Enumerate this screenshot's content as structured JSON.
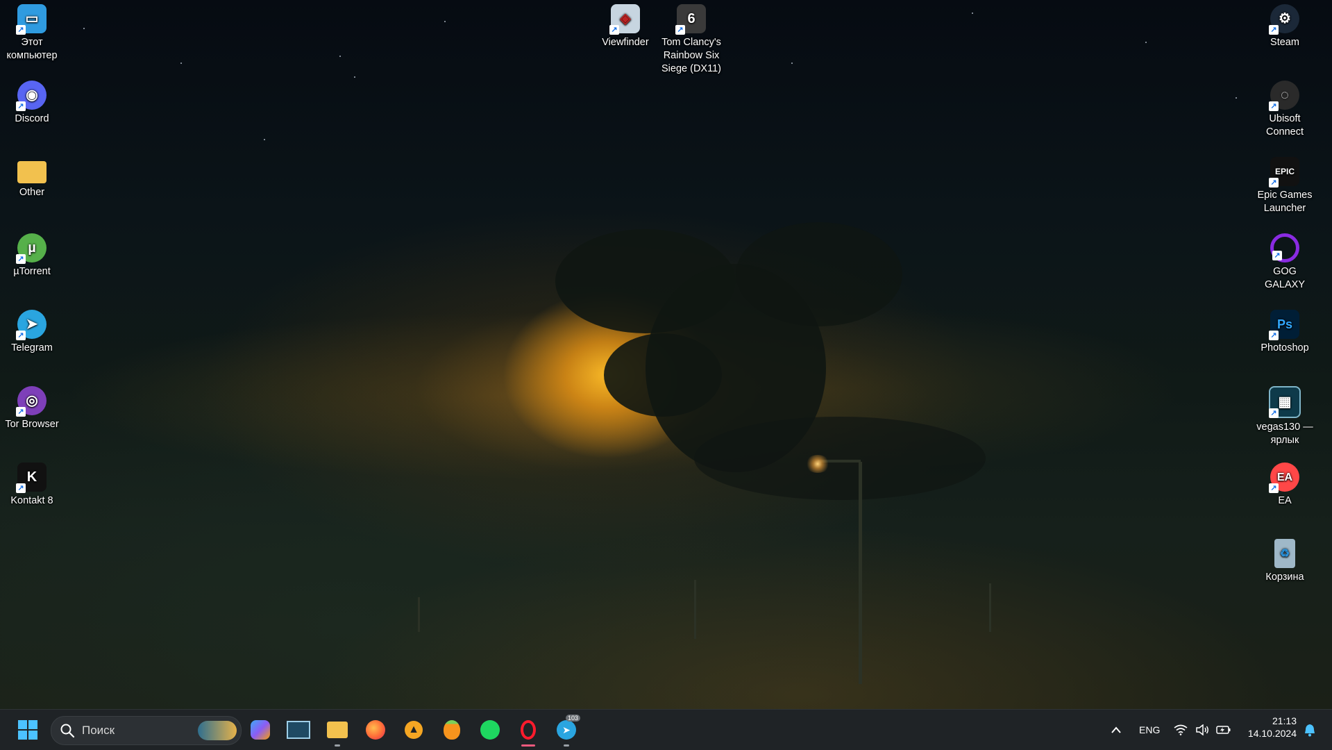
{
  "desktop": {
    "left_icons": [
      {
        "label": "Этот компьютер",
        "icon": "this-pc-icon",
        "color": "#2f9be0"
      },
      {
        "label": "Discord",
        "icon": "discord-icon",
        "color": "#5865f2"
      },
      {
        "label": "Other",
        "icon": "folder-icon",
        "color": "#f2c14e"
      },
      {
        "label": "µTorrent",
        "icon": "utorrent-icon",
        "color": "#56b04a"
      },
      {
        "label": "Telegram",
        "icon": "telegram-icon",
        "color": "#2aa5e0"
      },
      {
        "label": "Tor Browser",
        "icon": "tor-browser-icon",
        "color": "#7e3fb9"
      },
      {
        "label": "Kontakt 8",
        "icon": "kontakt-icon",
        "color": "#111111"
      }
    ],
    "top_icons": [
      {
        "label": "Viewfinder",
        "icon": "viewfinder-icon",
        "color": "#c7d5e0"
      },
      {
        "label": "Tom Clancy's Rainbow Six Siege (DX11)",
        "icon": "rainbow-six-icon",
        "color": "#3a3a3a"
      }
    ],
    "right_icons": [
      {
        "label": "Steam",
        "icon": "steam-icon",
        "color": "#1b2838"
      },
      {
        "label": "Ubisoft Connect",
        "icon": "ubisoft-icon",
        "color": "#2a2a2a"
      },
      {
        "label": "Epic Games Launcher",
        "icon": "epic-games-icon",
        "color": "#111111"
      },
      {
        "label": "GOG GALAXY",
        "icon": "gog-galaxy-icon",
        "color": "#8a2be2"
      },
      {
        "label": "Photoshop",
        "icon": "photoshop-icon",
        "color": "#001e36"
      },
      {
        "label": "vegas130 — ярлык",
        "icon": "vegas-icon",
        "color": "#0e3a4a"
      },
      {
        "label": "EA",
        "icon": "ea-icon",
        "color": "#ff4747"
      },
      {
        "label": "Корзина",
        "icon": "recycle-bin-icon",
        "color": "#9fb8c8"
      }
    ]
  },
  "taskbar": {
    "search_placeholder": "Поиск",
    "apps": [
      {
        "name": "copilot",
        "icon": "copilot-icon",
        "running": false
      },
      {
        "name": "resource-monitor",
        "icon": "monitor-icon",
        "running": false
      },
      {
        "name": "file-explorer",
        "icon": "file-explorer-icon",
        "running": true
      },
      {
        "name": "firefox",
        "icon": "firefox-icon",
        "running": false
      },
      {
        "name": "aimp",
        "icon": "aimp-icon",
        "running": false
      },
      {
        "name": "fl-studio",
        "icon": "fl-studio-icon",
        "running": false
      },
      {
        "name": "spotify",
        "icon": "spotify-icon",
        "running": false
      },
      {
        "name": "opera",
        "icon": "opera-icon",
        "running": true,
        "active": true
      },
      {
        "name": "telegram",
        "icon": "telegram-icon",
        "running": true,
        "badge": "103"
      }
    ],
    "tray": {
      "language": "ENG",
      "time": "21:13",
      "date": "14.10.2024"
    }
  }
}
